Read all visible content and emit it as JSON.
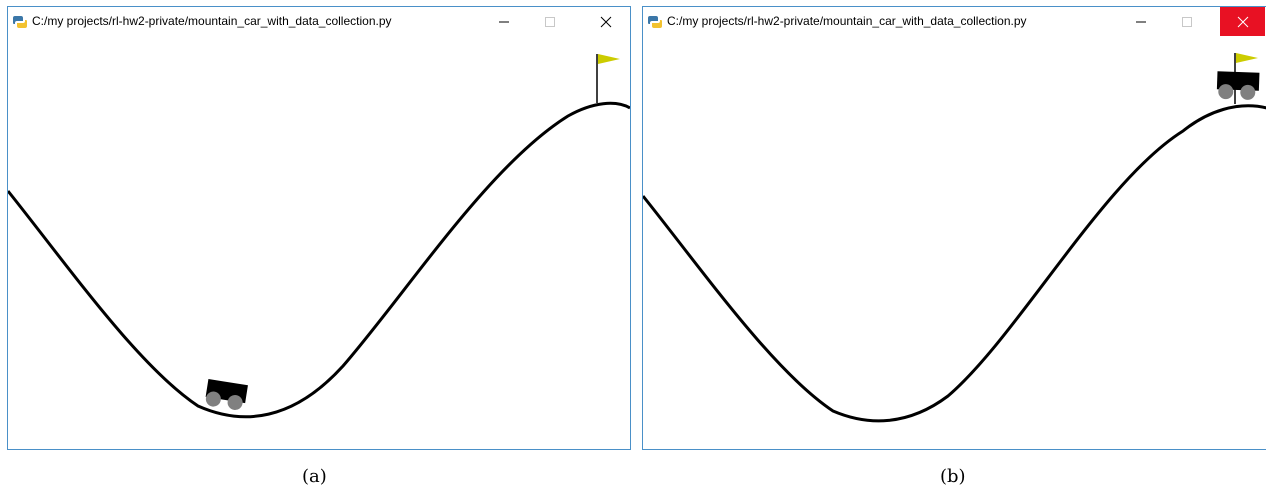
{
  "panels": [
    {
      "window_title": "C:/my projects/rl-hw2-private/mountain_car_with_data_collection.py",
      "caption": "(a)",
      "close_button_active": false,
      "controls": [
        "minimize-icon",
        "maximize-icon",
        "close-icon"
      ]
    },
    {
      "window_title": "C:/my projects/rl-hw2-private/mountain_car_with_data_collection.py",
      "caption": "(b)",
      "close_button_active": true,
      "controls": [
        "minimize-icon",
        "maximize-icon",
        "close-icon"
      ]
    }
  ],
  "colors": {
    "window_border": "#4a90c8",
    "track": "#000000",
    "flag": "#cccc00",
    "wheel": "#808080",
    "close_active": "#e81123"
  }
}
